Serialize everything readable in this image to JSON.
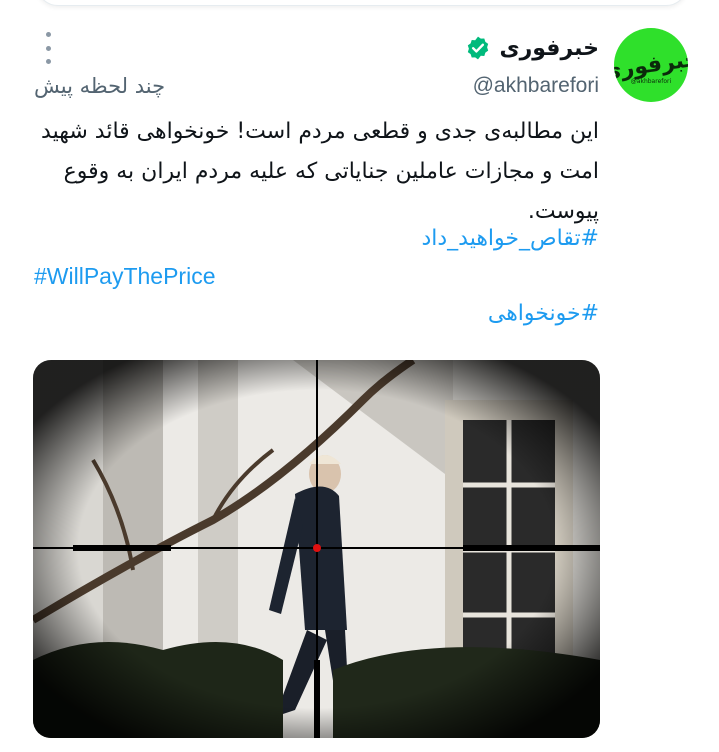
{
  "account": {
    "display_name": "خبرفوری",
    "handle": "@akhbarefori",
    "verified": true,
    "avatar_logo_text": "خبرفوری",
    "avatar_sub_text": "@akhbarefori",
    "avatar_color": "#2fe02b"
  },
  "tweet": {
    "timestamp": "چند لحظه پیش",
    "body": "این مطالبه‌ی جدی و قطعی مردم است! خونخواهی قائد شهید امت و مجازات عاملین جنایاتی که علیه مردم ایران به وقوع پیوست.",
    "hashtags": [
      "#تقاص_خواهید_داد",
      "#WillPayThePrice",
      "#خونخواهی"
    ]
  },
  "media": {
    "description_icon": "scope-crosshair-icon"
  },
  "colors": {
    "link": "#1d9bf0",
    "muted": "#536471",
    "verified": "#00ba7c"
  }
}
